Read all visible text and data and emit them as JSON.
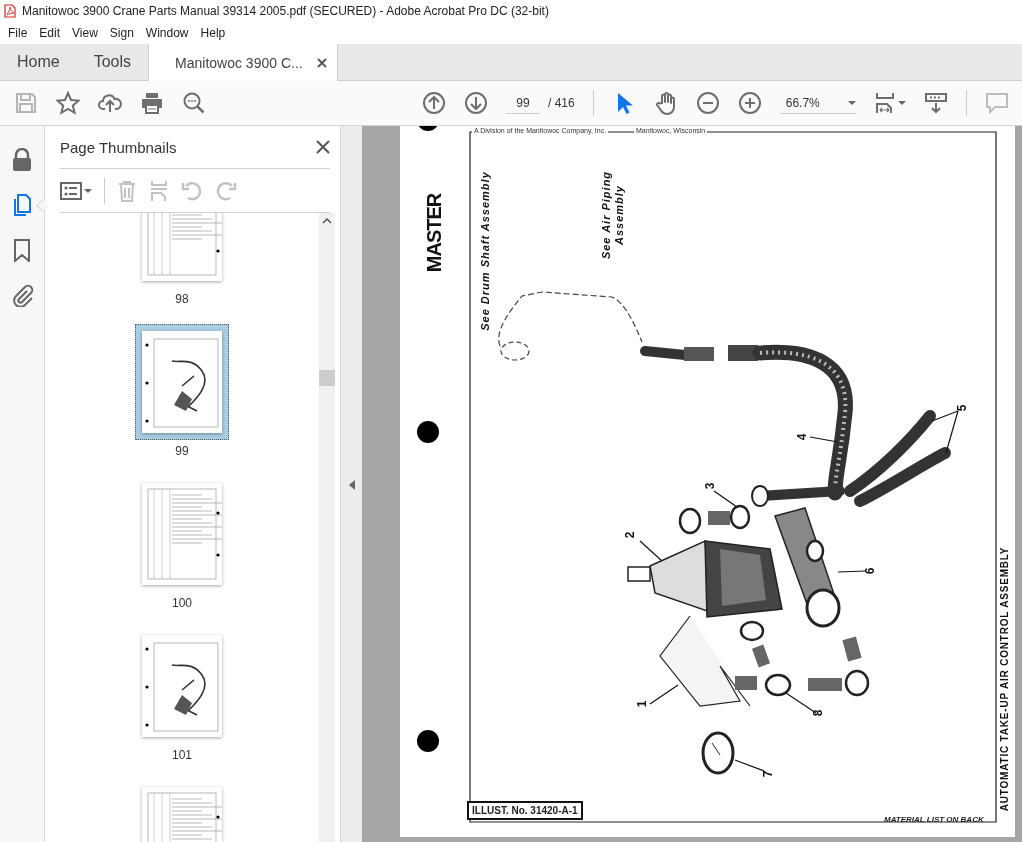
{
  "window": {
    "title": "Manitowoc 3900 Crane Parts Manual 39314 2005.pdf (SECURED) - Adobe Acrobat Pro DC (32-bit)"
  },
  "menu": [
    "File",
    "Edit",
    "View",
    "Sign",
    "Window",
    "Help"
  ],
  "tabs": [
    {
      "label": "Home",
      "selected": false,
      "kind": "nav"
    },
    {
      "label": "Tools",
      "selected": false,
      "kind": "nav"
    },
    {
      "label": "Manitowoc 3900 C...",
      "selected": true,
      "kind": "document"
    }
  ],
  "toolbar": {
    "page_number": "99",
    "page_separator": "/",
    "page_count": "416",
    "zoom": "66.7%",
    "tools": [
      {
        "kind": "select",
        "selected": true
      },
      {
        "kind": "hand",
        "selected": false
      }
    ]
  },
  "panels": [
    {
      "kind": "lock",
      "selected": false
    },
    {
      "kind": "pages",
      "selected": true
    },
    {
      "kind": "bookmarks",
      "selected": false
    },
    {
      "kind": "attachments",
      "selected": false
    }
  ],
  "thumbnails_panel": {
    "title": "Page Thumbnails",
    "pages": [
      {
        "label": "98",
        "kind": "table",
        "selected": false
      },
      {
        "label": "99",
        "kind": "drawing",
        "selected": true
      },
      {
        "label": "100",
        "kind": "table",
        "selected": false
      },
      {
        "label": "101",
        "kind": "drawing",
        "selected": false
      },
      {
        "kind": "table",
        "selected": false
      }
    ]
  },
  "document": {
    "header_left": "A Division of the Manitowoc Company, Inc.",
    "header_right": "Manitowoc, Wisconsin",
    "stamp": "MASTER",
    "callouts": [
      "See Drum Shaft Assembly",
      "See Air Piping Assembly"
    ],
    "part_numbers": [
      "1",
      "2",
      "3",
      "4",
      "5",
      "6",
      "7",
      "8"
    ],
    "illustration_number": "ILLUST. No. 31420-A-1",
    "footer": "MATERIAL LIST ON BACK",
    "side_title": "AUTOMATIC TAKE-UP AIR CONTROL ASSEMBLY"
  }
}
